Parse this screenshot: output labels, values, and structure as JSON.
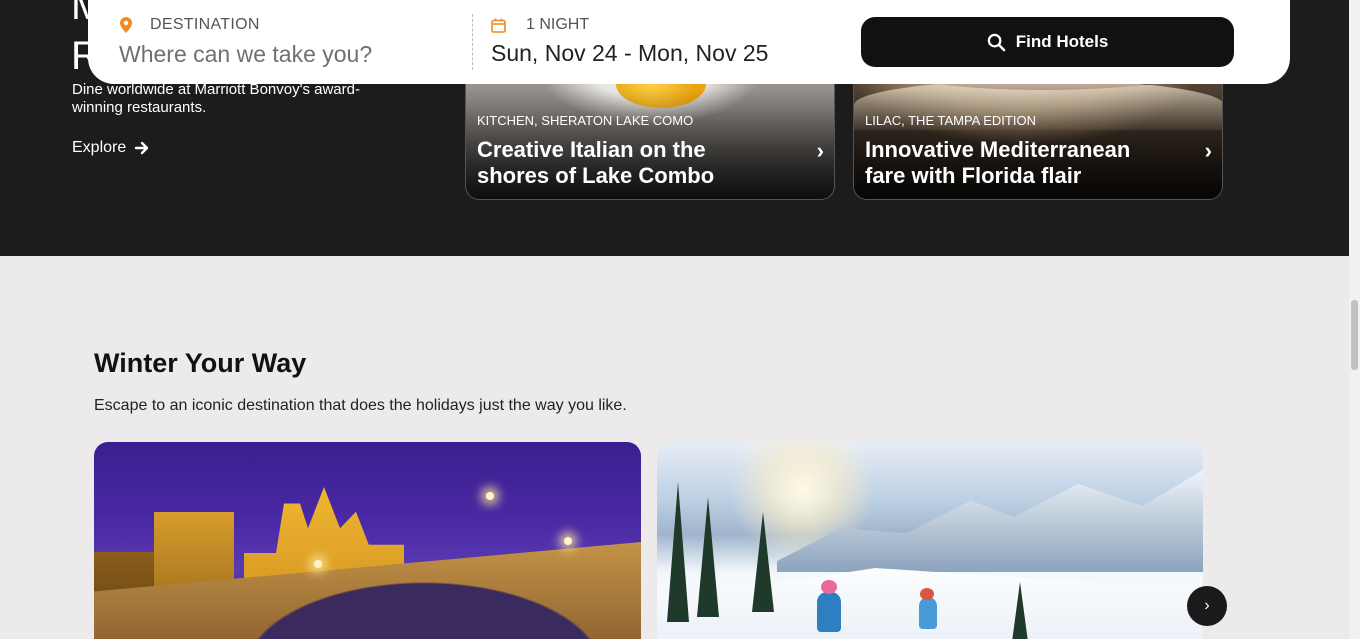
{
  "dining": {
    "heading_fragment_1": "M",
    "heading_fragment_2": "R",
    "description": "Dine worldwide at Marriott Bonvoy's award-winning restaurants.",
    "explore_label": "Explore",
    "cards": [
      {
        "eyebrow": "KITCHEN, SHERATON LAKE COMO",
        "title": "Creative Italian on the shores of Lake Combo",
        "chevron": "›"
      },
      {
        "eyebrow": "LILAC, THE TAMPA EDITION",
        "title": "Innovative Mediterranean fare with Florida flair",
        "chevron": "›"
      }
    ]
  },
  "search": {
    "destination_label": "DESTINATION",
    "destination_placeholder": "Where can we take you?",
    "destination_value": "",
    "nights_label": "1 NIGHT",
    "date_range": "Sun, Nov 24 - Mon, Nov 25",
    "find_button_label": "Find Hotels",
    "accent_color": "#f08a24"
  },
  "winter": {
    "title": "Winter Your Way",
    "subtitle": "Escape to an iconic destination that does the holidays just the way you like.",
    "next_label": "›"
  },
  "icons": {
    "destination": "map-pin-icon",
    "date": "calendar-icon",
    "search": "search-icon",
    "explore": "arrow-right-icon",
    "next": "chevron-right-icon"
  }
}
